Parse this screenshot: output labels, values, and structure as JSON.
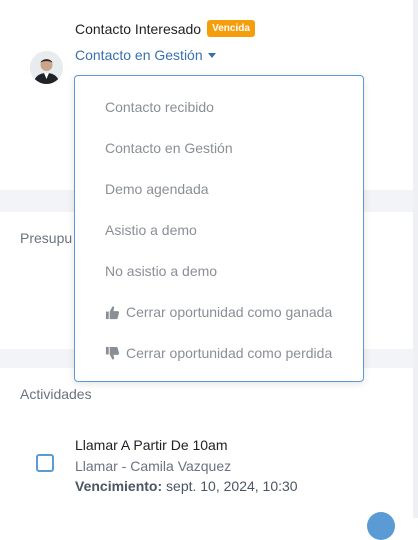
{
  "contact": {
    "title": "Contacto Interesado",
    "badge": "Vencida",
    "stage": "Contacto en Gestión"
  },
  "sections": {
    "presupuesto_partial": "Presupu",
    "actividades": "Actividades"
  },
  "dropdown": {
    "items": [
      {
        "label": "Contacto recibido",
        "icon": ""
      },
      {
        "label": "Contacto en Gestión",
        "icon": ""
      },
      {
        "label": "Demo agendada",
        "icon": ""
      },
      {
        "label": "Asistio a demo",
        "icon": ""
      },
      {
        "label": "No asistio a demo",
        "icon": ""
      },
      {
        "label": "Cerrar oportunidad como ganada",
        "icon": "thumbs-up-icon"
      },
      {
        "label": "Cerrar oportunidad como perdida",
        "icon": "thumbs-down-icon"
      }
    ]
  },
  "activity": {
    "title": "Llamar A Partir De 10am",
    "subtitle": "Llamar - Camila Vazquez",
    "due_label": "Vencimiento:",
    "due_value": "sept. 10, 2024, 10:30"
  },
  "colors": {
    "accent": "#3a6fb0",
    "badge": "#f59e0b",
    "border": "#5b9bd5"
  }
}
